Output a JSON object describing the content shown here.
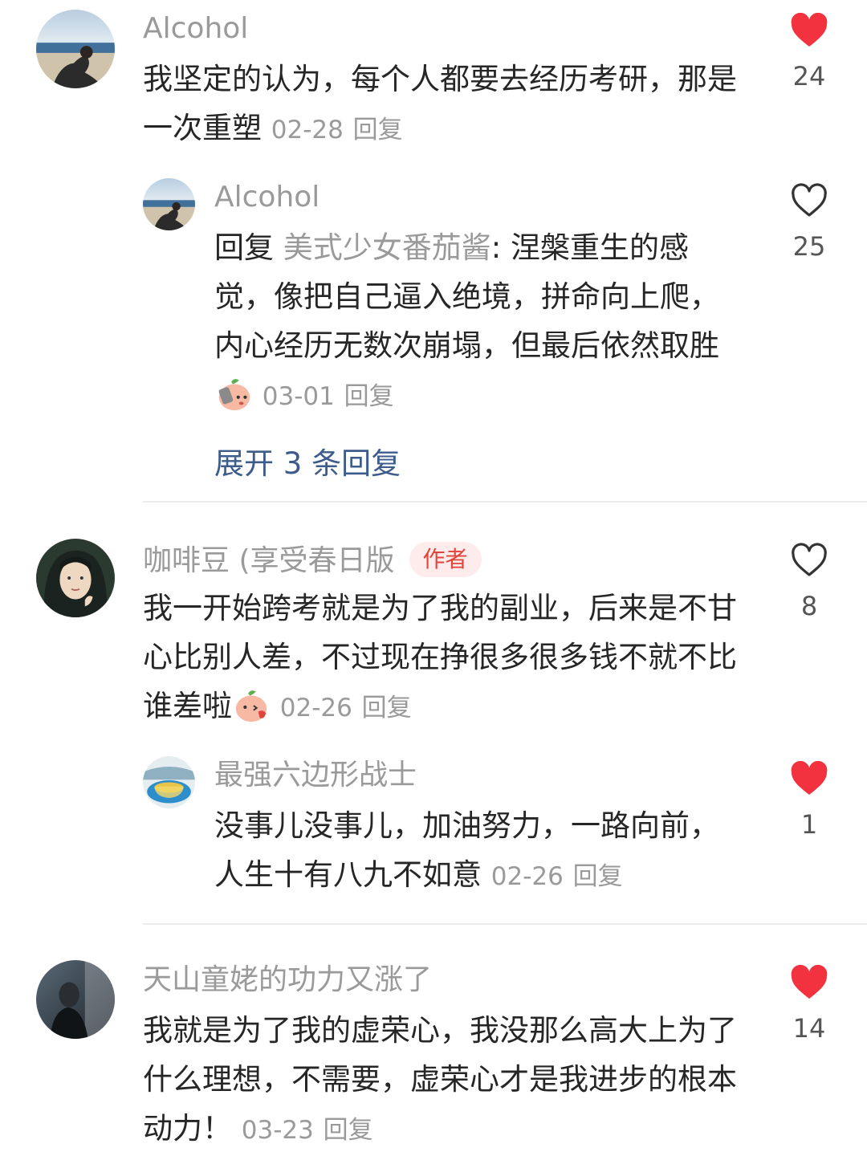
{
  "comments": [
    {
      "username": "Alcohol",
      "text": "我坚定的认为，每个人都要去经历考研，那是一次重塑",
      "date": "02-28",
      "reply_label": "回复",
      "likes": "24",
      "liked": true,
      "avatar_icon": "beach-person-avatar",
      "replies": [
        {
          "username": "Alcohol",
          "reply_prefix": "回复 ",
          "reply_to": "美式少女番茄酱",
          "text": ": 涅槃重生的感觉，像把自己逼入绝境，拼命向上爬，内心经历无数次崩塌，但最后依然取胜",
          "emoji": "phone-peach-emoji",
          "date": "03-01",
          "reply_label": "回复",
          "likes": "25",
          "liked": false,
          "avatar_icon": "beach-person-avatar"
        }
      ],
      "expand_label": "展开 3 条回复"
    },
    {
      "username": "咖啡豆 (享受春日版",
      "badge": "作者",
      "text": "我一开始跨考就是为了我的副业，后来是不甘心比别人差，不过现在挣很多很多钱不就不比谁差啦",
      "emoji": "kiss-peach-emoji",
      "date": "02-26",
      "reply_label": "回复",
      "likes": "8",
      "liked": false,
      "avatar_icon": "girl-portrait-avatar",
      "replies": [
        {
          "username": "最强六边形战士",
          "text": "没事儿没事儿，加油努力，一路向前，人生十有八九不如意",
          "date": "02-26",
          "reply_label": "回复",
          "likes": "1",
          "liked": true,
          "avatar_icon": "tea-cup-avatar"
        }
      ]
    },
    {
      "username": "天山童姥的功力又涨了",
      "text": "我就是为了我的虚荣心，我没那么高大上为了什么理想，不需要，虚荣心才是我进步的根本动力！",
      "date": "03-23",
      "reply_label": "回复",
      "likes": "14",
      "liked": true,
      "avatar_icon": "dark-portrait-avatar"
    }
  ],
  "colors": {
    "heart_liked": "#f2333f",
    "heart_outline": "#333333",
    "link": "#3d5c8c",
    "meta": "#9a9a9a"
  }
}
